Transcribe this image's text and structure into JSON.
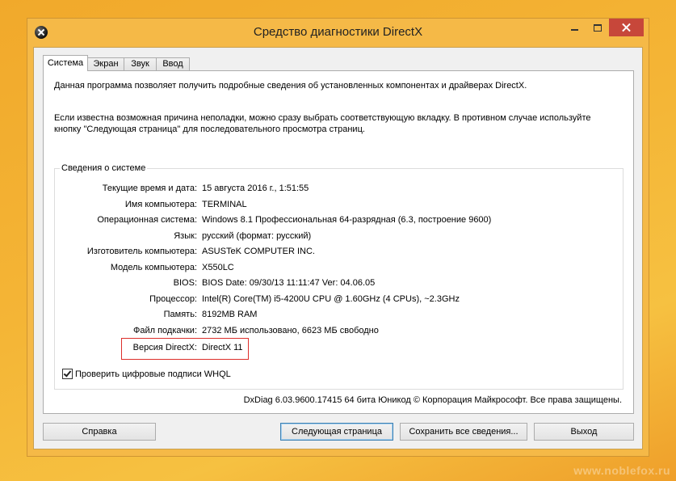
{
  "window": {
    "title": "Средство диагностики DirectX",
    "icon": "directx-icon"
  },
  "tabs": [
    {
      "label": "Система",
      "selected": true
    },
    {
      "label": "Экран",
      "selected": false
    },
    {
      "label": "Звук",
      "selected": false
    },
    {
      "label": "Ввод",
      "selected": false
    }
  ],
  "intro": {
    "p1": "Данная программа позволяет получить подробные сведения об установленных компонентах и драйверах DirectX.",
    "p2_line1": "Если известна возможная причина неполадки, можно сразу выбрать соответствующую вкладку. В противном случае используйте",
    "p2_line2": "кнопку \"Следующая страница\" для последовательного просмотра страниц."
  },
  "system_info": {
    "group_label": "Сведения о системе",
    "rows": [
      {
        "label": "Текущие время и дата:",
        "value": "15 августа 2016 г., 1:51:55"
      },
      {
        "label": "Имя компьютера:",
        "value": "TERMINAL"
      },
      {
        "label": "Операционная система:",
        "value": "Windows 8.1 Профессиональная 64-разрядная (6.3, построение 9600)"
      },
      {
        "label": "Язык:",
        "value": "русский (формат: русский)"
      },
      {
        "label": "Изготовитель компьютера:",
        "value": "ASUSTeK COMPUTER INC."
      },
      {
        "label": "Модель компьютера:",
        "value": "X550LC"
      },
      {
        "label": "BIOS:",
        "value": "BIOS Date: 09/30/13 11:11:47 Ver: 04.06.05"
      },
      {
        "label": "Процессор:",
        "value": "Intel(R) Core(TM) i5-4200U CPU @ 1.60GHz (4 CPUs), ~2.3GHz"
      },
      {
        "label": "Память:",
        "value": "8192MB RAM"
      },
      {
        "label": "Файл подкачки:",
        "value": "2732 МБ использовано, 6623 МБ свободно"
      }
    ],
    "directx": {
      "label": "Версия DirectX:",
      "value": "DirectX 11"
    },
    "whql_checkbox": {
      "label": "Проверить цифровые подписи WHQL",
      "checked": true
    }
  },
  "footer_text": "DxDiag 6.03.9600.17415 64 бита Юникод © Корпорация Майкрософт. Все права защищены.",
  "buttons": {
    "help": {
      "label": "Справка",
      "default": false
    },
    "next_page": {
      "label": "Следующая страница",
      "default": true
    },
    "save_all": {
      "label": "Сохранить все сведения...",
      "default": false
    },
    "exit": {
      "label": "Выход",
      "default": false
    }
  },
  "watermark": "www.noblefox.ru",
  "colors": {
    "frame": "#F5B947",
    "close_button": "#C7473A",
    "highlight_box": "#DD2E2A",
    "default_button_border": "#3C7FB1"
  }
}
